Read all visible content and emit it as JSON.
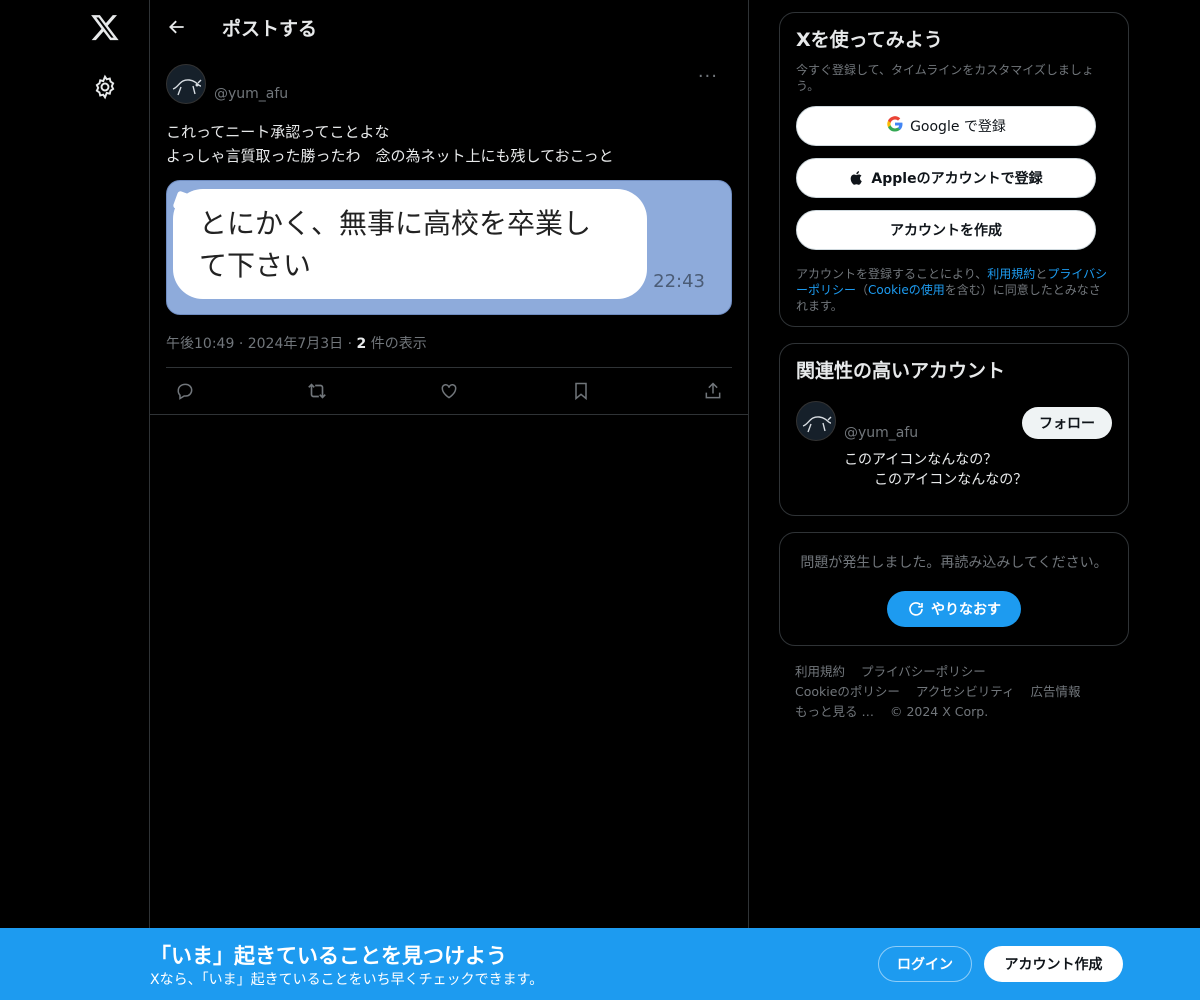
{
  "nav": {
    "logo_icon": "x-logo-icon",
    "settings_icon": "gear-icon"
  },
  "header": {
    "title": "ポストする",
    "back_icon": "arrow-left-icon"
  },
  "tweet": {
    "handle": "@yum_afu",
    "more": "···",
    "text_lines": [
      "これってニート承認ってことよな",
      "よっしゃ言質取った勝ったわ　念の為ネット上にも残しておこっと"
    ],
    "media": {
      "bubble_lines": [
        "とにかく、無事に高校を卒業し",
        "て下さい"
      ],
      "time": "22:43"
    },
    "meta": {
      "time": "午後10:49",
      "sep1": "·",
      "date": "2024年7月3日",
      "sep2": "·",
      "views_count": "2",
      "views_label": "件の表示"
    },
    "actions": [
      "reply-icon",
      "retweet-icon",
      "like-icon",
      "bookmark-icon",
      "share-icon"
    ]
  },
  "signup_card": {
    "title": "Xを使ってみよう",
    "subtitle": "今すぐ登録して、タイムラインをカスタマイズしましょう。",
    "google_btn": "Google で登録",
    "apple_btn": "Appleのアカウントで登録",
    "create_btn": "アカウントを作成",
    "legal_pre": "アカウントを登録することにより、",
    "legal_terms": "利用規約",
    "legal_and": "と",
    "legal_privacy": "プライバシーポリシー",
    "legal_paren_open": "（",
    "legal_cookie": "Cookieの使用",
    "legal_post": "を含む）に同意したとみなされます。"
  },
  "related_card": {
    "title": "関連性の高いアカウント",
    "handle": "@yum_afu",
    "follow_btn": "フォロー",
    "bio_line1": "このアイコンなんなの？",
    "bio_line2": "このアイコンなんなの？"
  },
  "error_card": {
    "message": "問題が発生しました。再読み込みしてください。",
    "retry_btn": "やりなおす"
  },
  "footer": {
    "links_row1": [
      "利用規約",
      "プライバシーポリシー"
    ],
    "links_row2": [
      "Cookieのポリシー",
      "アクセシビリティ",
      "広告情報"
    ],
    "more": "もっと見る …",
    "copyright": "© 2024 X Corp."
  },
  "bottom_bar": {
    "title": "「いま」起きていることを見つけよう",
    "subtitle": "Xなら、「いま」起きていることをいち早くチェックできます。",
    "login_btn": "ログイン",
    "signup_btn": "アカウント作成"
  },
  "colors": {
    "accent": "#1d9bf0",
    "background": "#000000",
    "media_bg": "#8eabdb"
  }
}
